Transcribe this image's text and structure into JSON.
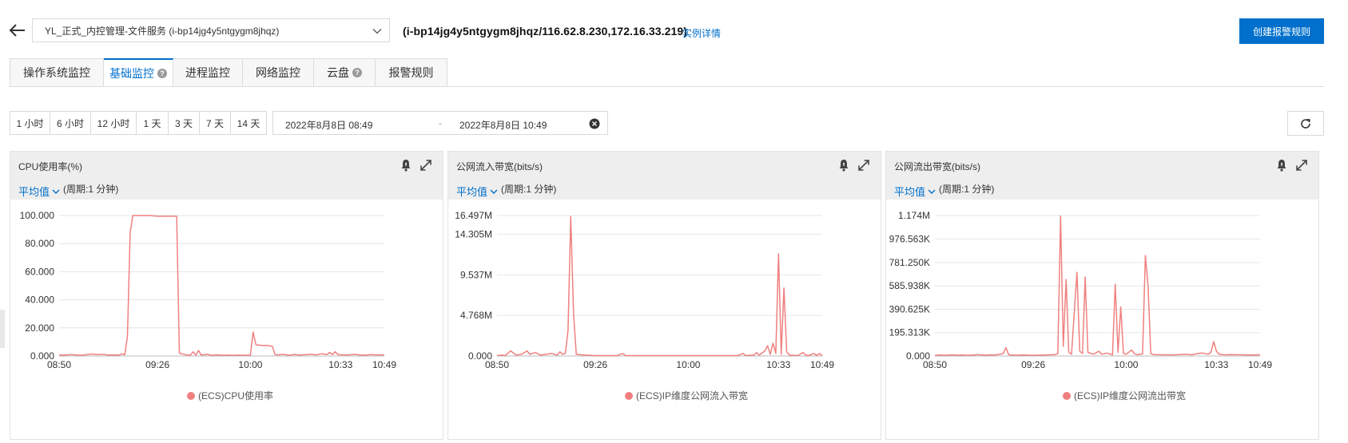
{
  "header": {
    "instance_select": "YL_正式_内控管理-文件服务 (i-bp14jg4y5ntgygm8jhqz)",
    "instance_info": "(i-bp14jg4y5ntgygm8jhqz/116.62.8.230,172.16.33.219)",
    "instance_detail_link": "实例详情",
    "create_alarm_button": "创建报警规则"
  },
  "tabs": [
    {
      "label": "操作系统监控",
      "active": false,
      "help": false
    },
    {
      "label": "基础监控",
      "active": true,
      "help": true
    },
    {
      "label": "进程监控",
      "active": false,
      "help": false
    },
    {
      "label": "网络监控",
      "active": false,
      "help": false
    },
    {
      "label": "云盘",
      "active": false,
      "help": true
    },
    {
      "label": "报警规则",
      "active": false,
      "help": false
    }
  ],
  "help_glyph": "?",
  "time_range": {
    "buttons": [
      "1 小时",
      "6 小时",
      "12 小时",
      "1 天",
      "3 天",
      "7 天",
      "14 天"
    ],
    "start": "2022年8月8日 08:49",
    "separator": "-",
    "end": "2022年8月8日 10:49"
  },
  "colors": {
    "accent": "#0070cc",
    "series": "#f08080",
    "grid": "#e6e6e6"
  },
  "panels": [
    {
      "title": "CPU使用率(%)",
      "aggregation": "平均值",
      "period": "(周期:1 分钟)",
      "legend": "(ECS)CPU使用率"
    },
    {
      "title": "公网流入带宽(bits/s)",
      "aggregation": "平均值",
      "period": "(周期:1 分钟)",
      "legend": "(ECS)IP维度公网流入带宽"
    },
    {
      "title": "公网流出带宽(bits/s)",
      "aggregation": "平均值",
      "period": "(周期:1 分钟)",
      "legend": "(ECS)IP维度公网流出带宽"
    }
  ],
  "chart_data": [
    {
      "type": "line",
      "title": "CPU使用率(%)",
      "x_range": [
        "08:50",
        "10:49"
      ],
      "x_ticks": [
        {
          "label": "08:50",
          "t": 0
        },
        {
          "label": "09:26",
          "t": 36
        },
        {
          "label": "10:00",
          "t": 70
        },
        {
          "label": "10:33",
          "t": 103
        },
        {
          "label": "10:49",
          "t": 119
        }
      ],
      "ylim": [
        0,
        100
      ],
      "y_ticks": [
        {
          "label": "0.000",
          "v": 0
        },
        {
          "label": "20.000",
          "v": 20
        },
        {
          "label": "40.000",
          "v": 40
        },
        {
          "label": "60.000",
          "v": 60
        },
        {
          "label": "80.000",
          "v": 80
        },
        {
          "label": "100.000",
          "v": 100
        }
      ],
      "grid": true,
      "series": [
        {
          "name": "(ECS)CPU使用率",
          "points": [
            [
              0,
              0.8
            ],
            [
              2,
              0.6
            ],
            [
              4,
              1.0
            ],
            [
              6,
              0.8
            ],
            [
              8,
              0.5
            ],
            [
              10,
              0.9
            ],
            [
              12,
              1.4
            ],
            [
              14,
              1.0
            ],
            [
              16,
              1.2
            ],
            [
              18,
              0.6
            ],
            [
              20,
              0.8
            ],
            [
              22,
              0.6
            ],
            [
              23,
              1.5
            ],
            [
              24,
              0.9
            ],
            [
              25,
              14
            ],
            [
              26,
              88
            ],
            [
              27,
              100
            ],
            [
              30,
              100
            ],
            [
              33,
              100
            ],
            [
              36,
              99.5
            ],
            [
              38,
              99.5
            ],
            [
              40,
              99.5
            ],
            [
              42,
              99.5
            ],
            [
              43,
              99.5
            ],
            [
              44,
              2
            ],
            [
              46,
              1
            ],
            [
              48,
              0.5
            ],
            [
              49,
              3
            ],
            [
              50,
              0.5
            ],
            [
              51,
              4
            ],
            [
              52,
              0.6
            ],
            [
              54,
              1.2
            ],
            [
              56,
              0.5
            ],
            [
              58,
              0.8
            ],
            [
              60,
              0.5
            ],
            [
              62,
              0.6
            ],
            [
              64,
              0.5
            ],
            [
              66,
              0.6
            ],
            [
              68,
              0.5
            ],
            [
              70,
              0.6
            ],
            [
              71,
              17
            ],
            [
              72,
              8
            ],
            [
              74,
              7.5
            ],
            [
              76,
              7.5
            ],
            [
              78,
              7
            ],
            [
              79,
              1
            ],
            [
              80,
              0.8
            ],
            [
              82,
              1.2
            ],
            [
              84,
              0.5
            ],
            [
              86,
              1.1
            ],
            [
              88,
              0.7
            ],
            [
              90,
              0.9
            ],
            [
              92,
              1.3
            ],
            [
              94,
              0.8
            ],
            [
              96,
              1.6
            ],
            [
              98,
              1.1
            ],
            [
              99,
              2.5
            ],
            [
              100,
              1
            ],
            [
              101,
              3
            ],
            [
              102,
              1
            ],
            [
              104,
              0.8
            ],
            [
              106,
              0.8
            ],
            [
              108,
              1.2
            ],
            [
              110,
              0.7
            ],
            [
              112,
              0.6
            ],
            [
              114,
              1
            ],
            [
              116,
              0.8
            ],
            [
              119,
              0.8
            ]
          ]
        }
      ]
    },
    {
      "type": "line",
      "title": "公网流入带宽(bits/s)",
      "x_range": [
        "08:50",
        "10:49"
      ],
      "x_ticks": [
        {
          "label": "08:50",
          "t": 0
        },
        {
          "label": "09:26",
          "t": 36
        },
        {
          "label": "10:00",
          "t": 70
        },
        {
          "label": "10:33",
          "t": 103
        },
        {
          "label": "10:49",
          "t": 119
        }
      ],
      "ylim": [
        0,
        16.497
      ],
      "y_unit": "M",
      "y_ticks": [
        {
          "label": "0.000",
          "v": 0
        },
        {
          "label": "4.768M",
          "v": 4.768
        },
        {
          "label": "9.537M",
          "v": 9.537
        },
        {
          "label": "14.305M",
          "v": 14.305
        },
        {
          "label": "16.497M",
          "v": 16.497
        }
      ],
      "grid": true,
      "series": [
        {
          "name": "(ECS)IP维度公网流入带宽",
          "points": [
            [
              0,
              0.05
            ],
            [
              2,
              0.1
            ],
            [
              3,
              0.05
            ],
            [
              5,
              0.6
            ],
            [
              7,
              0.1
            ],
            [
              9,
              0.2
            ],
            [
              11,
              0.6
            ],
            [
              12,
              0.2
            ],
            [
              14,
              0.4
            ],
            [
              16,
              0.1
            ],
            [
              18,
              0.2
            ],
            [
              20,
              0.3
            ],
            [
              22,
              0.1
            ],
            [
              23,
              0.5
            ],
            [
              24,
              0.2
            ],
            [
              25,
              0.3
            ],
            [
              26,
              3
            ],
            [
              27,
              16.4
            ],
            [
              28,
              5
            ],
            [
              29,
              0.2
            ],
            [
              32,
              0.1
            ],
            [
              36,
              0.05
            ],
            [
              40,
              0.05
            ],
            [
              44,
              0.05
            ],
            [
              46,
              0.3
            ],
            [
              47,
              0.05
            ],
            [
              52,
              0.05
            ],
            [
              56,
              0.05
            ],
            [
              60,
              0.05
            ],
            [
              64,
              0.05
            ],
            [
              68,
              0.05
            ],
            [
              72,
              0.05
            ],
            [
              76,
              0.05
            ],
            [
              80,
              0.05
            ],
            [
              88,
              0.05
            ],
            [
              90,
              0.3
            ],
            [
              91,
              0.05
            ],
            [
              94,
              0.1
            ],
            [
              95,
              0.4
            ],
            [
              96,
              0.1
            ],
            [
              98,
              0.6
            ],
            [
              99,
              1.2
            ],
            [
              100,
              0.2
            ],
            [
              101,
              1.5
            ],
            [
              102,
              0.3
            ],
            [
              103,
              12
            ],
            [
              104,
              0.2
            ],
            [
              105,
              8
            ],
            [
              106,
              0.5
            ],
            [
              107,
              0.1
            ],
            [
              110,
              0.05
            ],
            [
              112,
              0.4
            ],
            [
              113,
              0.1
            ],
            [
              114,
              0.05
            ],
            [
              116,
              0.3
            ],
            [
              117,
              0.05
            ],
            [
              118,
              0.3
            ],
            [
              119,
              0.05
            ]
          ]
        }
      ]
    },
    {
      "type": "line",
      "title": "公网流出带宽(bits/s)",
      "x_range": [
        "08:50",
        "10:49"
      ],
      "x_ticks": [
        {
          "label": "08:50",
          "t": 0
        },
        {
          "label": "09:26",
          "t": 36
        },
        {
          "label": "10:00",
          "t": 70
        },
        {
          "label": "10:33",
          "t": 103
        },
        {
          "label": "10:49",
          "t": 119
        }
      ],
      "ylim": [
        0,
        1174
      ],
      "y_unit": "K",
      "y_ticks": [
        {
          "label": "0.000",
          "v": 0
        },
        {
          "label": "195.313K",
          "v": 195.313
        },
        {
          "label": "390.625K",
          "v": 390.625
        },
        {
          "label": "585.938K",
          "v": 585.938
        },
        {
          "label": "781.250K",
          "v": 781.25
        },
        {
          "label": "976.563K",
          "v": 976.563
        },
        {
          "label": "1.174M",
          "v": 1174
        }
      ],
      "grid": true,
      "series": [
        {
          "name": "(ECS)IP维度公网流出带宽",
          "points": [
            [
              0,
              5
            ],
            [
              2,
              8
            ],
            [
              4,
              6
            ],
            [
              6,
              10
            ],
            [
              8,
              7
            ],
            [
              10,
              9
            ],
            [
              12,
              6
            ],
            [
              14,
              8
            ],
            [
              16,
              12
            ],
            [
              18,
              7
            ],
            [
              20,
              10
            ],
            [
              22,
              8
            ],
            [
              25,
              20
            ],
            [
              26,
              70
            ],
            [
              27,
              12
            ],
            [
              28,
              8
            ],
            [
              30,
              7
            ],
            [
              32,
              9
            ],
            [
              36,
              6
            ],
            [
              40,
              8
            ],
            [
              44,
              12
            ],
            [
              45,
              20
            ],
            [
              46,
              1170
            ],
            [
              47,
              80
            ],
            [
              48,
              640
            ],
            [
              49,
              30
            ],
            [
              50,
              15
            ],
            [
              52,
              700
            ],
            [
              53,
              40
            ],
            [
              54,
              20
            ],
            [
              55,
              660
            ],
            [
              56,
              30
            ],
            [
              58,
              15
            ],
            [
              60,
              40
            ],
            [
              61,
              15
            ],
            [
              63,
              25
            ],
            [
              65,
              10
            ],
            [
              66,
              600
            ],
            [
              67,
              30
            ],
            [
              68,
              410
            ],
            [
              69,
              20
            ],
            [
              70,
              15
            ],
            [
              72,
              50
            ],
            [
              73,
              20
            ],
            [
              74,
              10
            ],
            [
              76,
              18
            ],
            [
              77,
              840
            ],
            [
              78,
              580
            ],
            [
              79,
              20
            ],
            [
              80,
              12
            ],
            [
              84,
              10
            ],
            [
              88,
              10
            ],
            [
              92,
              15
            ],
            [
              94,
              10
            ],
            [
              96,
              20
            ],
            [
              98,
              25
            ],
            [
              100,
              15
            ],
            [
              101,
              30
            ],
            [
              102,
              120
            ],
            [
              103,
              40
            ],
            [
              104,
              15
            ],
            [
              106,
              10
            ],
            [
              108,
              12
            ],
            [
              112,
              10
            ],
            [
              116,
              8
            ],
            [
              119,
              10
            ]
          ]
        }
      ]
    }
  ]
}
